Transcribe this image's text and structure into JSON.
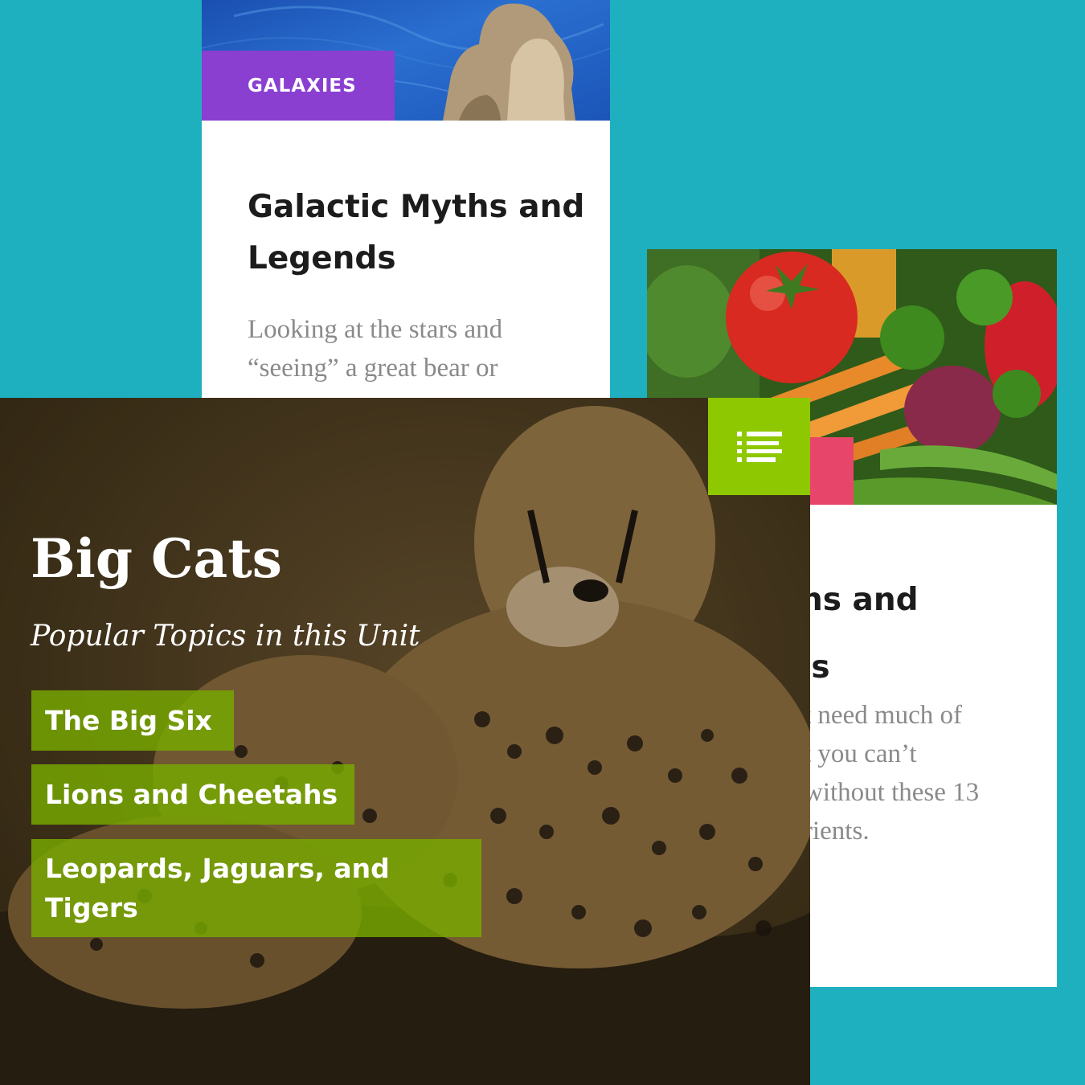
{
  "cards": {
    "galaxy": {
      "tag": "GALAXIES",
      "title": "Galactic Myths and Legends",
      "excerpt": "Looking at the stars and “seeing” a great bear or"
    },
    "nutrition": {
      "title_fragment_1": "ns and",
      "title_fragment_2": "ls",
      "excerpt_line_1": "t need much of",
      "excerpt_line_2": "t you can’t",
      "excerpt_line_3": "without these 13",
      "excerpt_line_4": "rients."
    },
    "big_cats": {
      "title": "Big Cats",
      "subtitle": "Popular Topics in this Unit",
      "topics": [
        "The Big Six",
        "Lions and Cheetahs",
        "Leopards, Jaguars, and Tigers"
      ],
      "menu_icon": "list-menu-icon"
    }
  },
  "colors": {
    "background": "#1fb0c0",
    "galaxy_tag": "#8a3fd0",
    "nutrition_tag": "#e8456a",
    "menu_button": "#8ec800",
    "topic_button": "#78aa00"
  }
}
